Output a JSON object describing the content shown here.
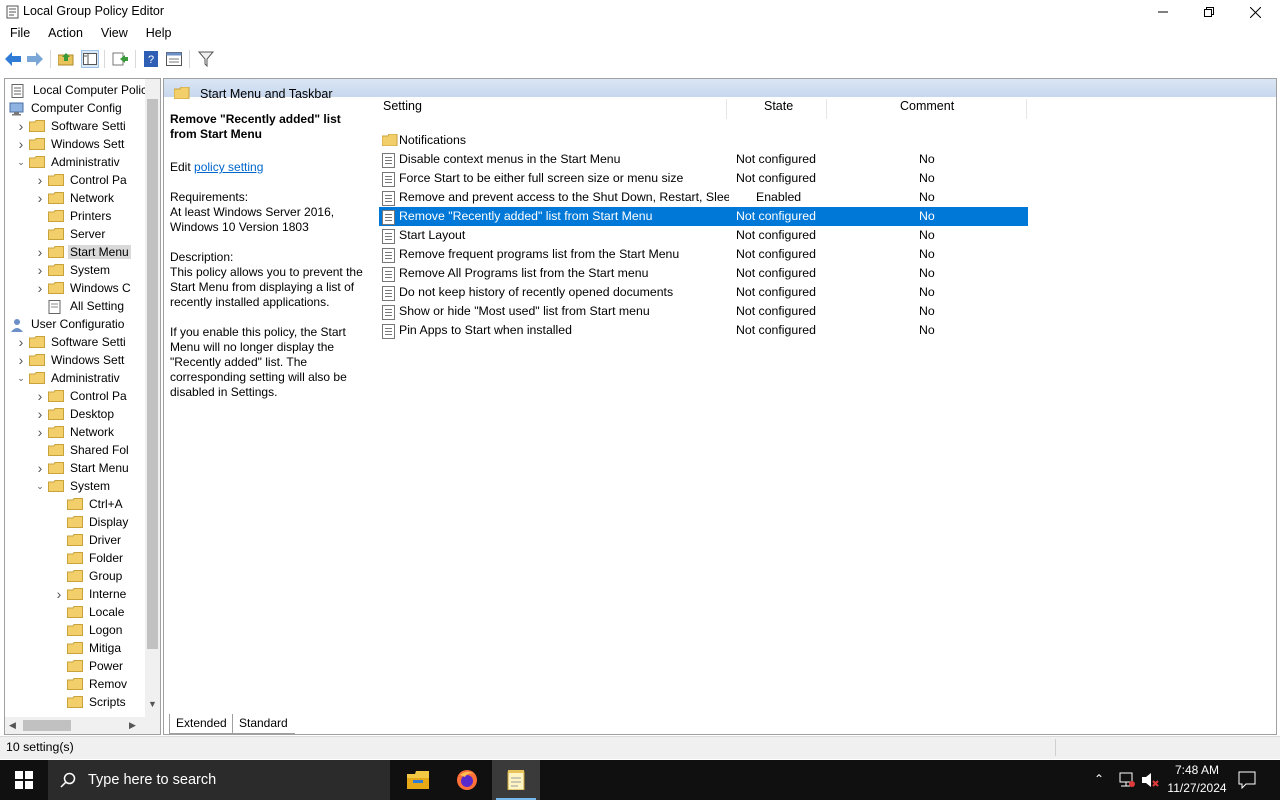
{
  "window": {
    "title": "Local Group Policy Editor",
    "minimize_icon": "minimize-icon",
    "restore_icon": "restore-icon",
    "close_icon": "close-icon"
  },
  "menu": [
    "File",
    "Action",
    "View",
    "Help"
  ],
  "toolbar": [
    "back-arrow-icon",
    "forward-arrow-icon",
    "up-folder-icon",
    "show-hide-tree-icon",
    "export-list-icon",
    "help-icon",
    "properties-icon",
    "filter-icon"
  ],
  "tree": {
    "root": "Local Computer Polic",
    "computer_config": "Computer Config",
    "cc_software": "Software Setti",
    "cc_windows": "Windows Sett",
    "cc_admin": "Administrativ",
    "cc_admin_items": [
      "Control Pa",
      "Network",
      "Printers",
      "Server",
      "Start Menu",
      "System",
      "Windows C",
      "All Setting"
    ],
    "user_config": "User Configuratio",
    "uc_software": "Software Setti",
    "uc_windows": "Windows Sett",
    "uc_admin": "Administrativ",
    "uc_admin_items": [
      "Control Pa",
      "Desktop",
      "Network",
      "Shared Fol",
      "Start Menu",
      "System"
    ],
    "uc_system_items": [
      "Ctrl+A",
      "Display",
      "Driver",
      "Folder",
      "Group",
      "Interne",
      "Locale",
      "Logon",
      "Mitiga",
      "Power",
      "Remov",
      "Scripts"
    ]
  },
  "right": {
    "section_title": "Start Menu and Taskbar",
    "columns": {
      "setting": "Setting",
      "state": "State",
      "comment": "Comment"
    },
    "description": {
      "title": "Remove \"Recently added\" list from Start Menu",
      "edit_prefix": "Edit ",
      "edit_link": "policy setting",
      "requirements_label": "Requirements:",
      "requirements": "At least Windows Server 2016, Windows 10 Version 1803",
      "description_label": "Description:",
      "description": "This policy allows you to prevent the Start Menu from displaying a list of recently installed applications.",
      "extra": "If you enable this policy, the Start Menu will no longer display the \"Recently added\" list.  The corresponding setting will also be disabled in Settings."
    },
    "folder_row": "Notifications",
    "rows": [
      {
        "name": "Disable context menus in the Start Menu",
        "state": "Not configured",
        "comment": "No"
      },
      {
        "name": "Force Start to be either full screen size or menu size",
        "state": "Not configured",
        "comment": "No"
      },
      {
        "name": "Remove and prevent access to the Shut Down, Restart, Sleep...",
        "state": "Enabled",
        "comment": "No"
      },
      {
        "name": "Remove \"Recently added\" list from Start Menu",
        "state": "Not configured",
        "comment": "No"
      },
      {
        "name": "Start Layout",
        "state": "Not configured",
        "comment": "No"
      },
      {
        "name": "Remove frequent programs list from the Start Menu",
        "state": "Not configured",
        "comment": "No"
      },
      {
        "name": "Remove All Programs list from the Start menu",
        "state": "Not configured",
        "comment": "No"
      },
      {
        "name": "Do not keep history of recently opened documents",
        "state": "Not configured",
        "comment": "No"
      },
      {
        "name": "Show or hide \"Most used\" list from Start menu",
        "state": "Not configured",
        "comment": "No"
      },
      {
        "name": "Pin Apps to Start when installed",
        "state": "Not configured",
        "comment": "No"
      }
    ],
    "tabs": [
      "Extended",
      "Standard"
    ]
  },
  "status": "10 setting(s)",
  "taskbar": {
    "search_placeholder": "Type here to search",
    "time": "7:48 AM",
    "date": "11/27/2024"
  },
  "colors": {
    "selection": "#0078d7",
    "header_band": "#c7d7ee",
    "taskbar": "#101010"
  }
}
